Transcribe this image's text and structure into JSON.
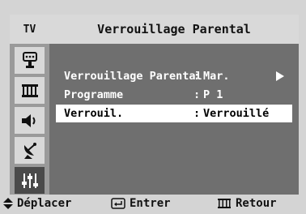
{
  "tab": {
    "label": "TV"
  },
  "title": "Verrouillage Parental",
  "sidebar": {
    "icons": [
      "setup-icon",
      "channel-list-icon",
      "speaker-icon",
      "satellite-dish-icon",
      "sliders-icon"
    ],
    "active_index": 4
  },
  "menu": {
    "rows": [
      {
        "label": "Verrouillage Parental",
        "separator": ":",
        "value": "Mar."
      },
      {
        "label": "Programme",
        "separator": ":",
        "value": "P 1"
      },
      {
        "label": "Verrouil.",
        "separator": ":",
        "value": "Verrouillé"
      }
    ],
    "selected_index": 2
  },
  "help": {
    "move": "Déplacer",
    "enter": "Entrer",
    "return": "Retour"
  },
  "colors": {
    "osd_background": "#6f6f6f",
    "header_background": "#d9d9d9",
    "selected_row": "#ffffff"
  }
}
